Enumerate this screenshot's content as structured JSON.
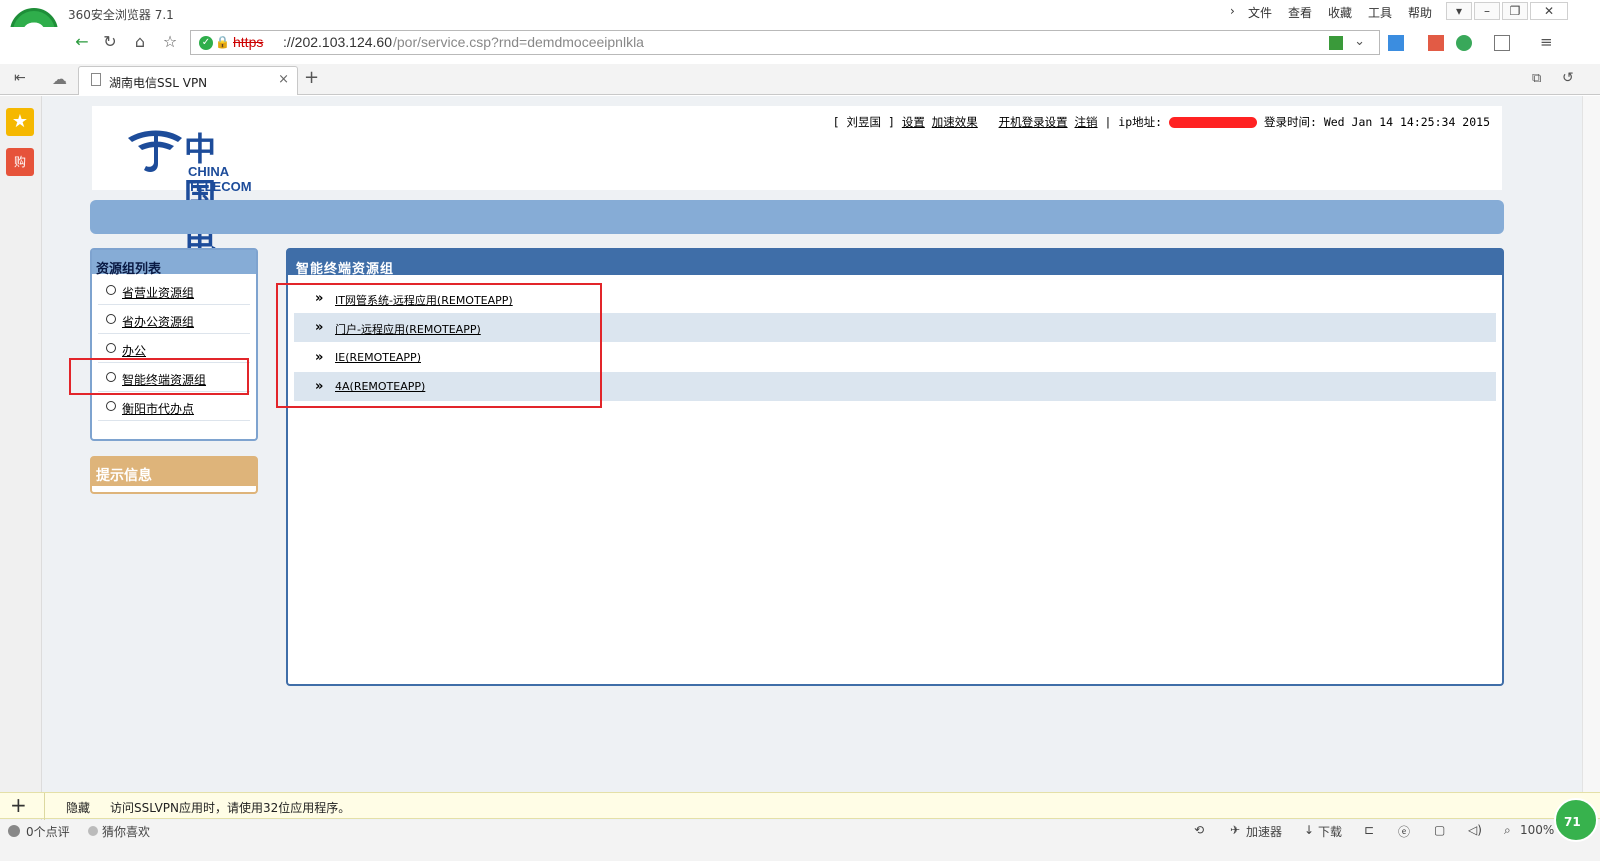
{
  "browser": {
    "app_title": "360安全浏览器 7.1",
    "menu": [
      "文件",
      "查看",
      "收藏",
      "工具",
      "帮助"
    ],
    "menu_chevron": "›",
    "address": {
      "scheme": "https",
      "host": "://202.103.124.60",
      "path": "/por/service.csp?rnd=demdmoceeipnlkla"
    },
    "tab": {
      "label": "湖南电信SSL VPN"
    },
    "icons": [
      "back-arrow-icon",
      "refresh-icon",
      "home-icon",
      "star-icon",
      "shield-icon",
      "lock-icon"
    ]
  },
  "header": {
    "logo_cn": "中国电信",
    "logo_en": "CHINA TELECOM",
    "user_bracket_open": "[",
    "user_name": "刘昱国",
    "user_bracket_close": "]",
    "link_settings": "设置",
    "link_accelerate": "加速效果",
    "link_boot_login": "开机登录设置",
    "link_logout": "注销",
    "ip_label": "| ip地址:",
    "login_time_label": "登录时间:",
    "login_time": "Wed Jan 14 14:25:34 2015"
  },
  "resource_panel": {
    "title": "资源组列表",
    "items": [
      {
        "label": "省营业资源组"
      },
      {
        "label": "省办公资源组"
      },
      {
        "label": "办公"
      },
      {
        "label": "智能终端资源组"
      },
      {
        "label": "衡阳市代办点"
      }
    ]
  },
  "tip_panel": {
    "title": "提示信息"
  },
  "main_panel": {
    "title": "智能终端资源组",
    "apps": [
      {
        "label": "IT网管系统-远程应用(REMOTEAPP)"
      },
      {
        "label": "门户-远程应用(REMOTEAPP)"
      },
      {
        "label": "IE(REMOTEAPP)"
      },
      {
        "label": "4A(REMOTEAPP)"
      }
    ],
    "arrow": "»"
  },
  "notice": {
    "hide_label": "隐藏",
    "text": "访问SSLVPN应用时，请使用32位应用程序。"
  },
  "statusbar": {
    "comments": "0个点评",
    "guess": "猜你喜欢",
    "accelerator": "加速器",
    "download": "下载",
    "zoom": "100%",
    "badge": "71"
  },
  "colors": {
    "accent_blue": "#3f6ea8",
    "light_blue": "#86acd6",
    "tip_gold": "#deb47a",
    "highlight_red": "#e2252a"
  }
}
